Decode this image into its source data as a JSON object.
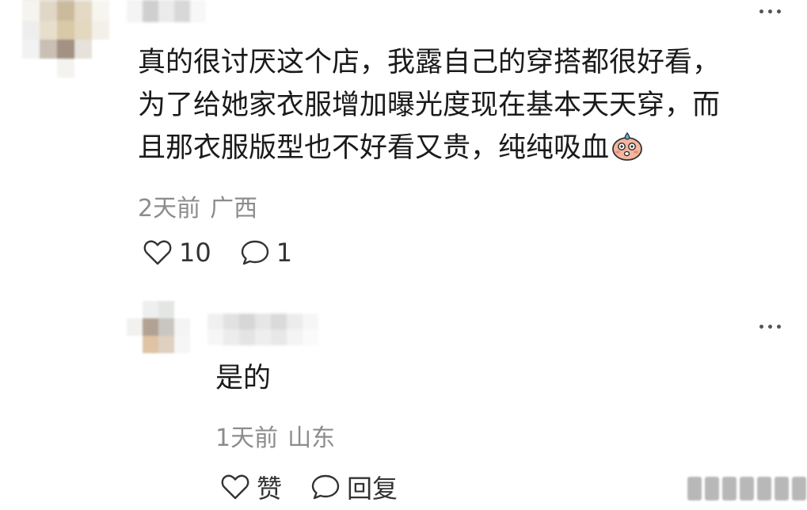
{
  "comment": {
    "text_lines": [
      "真的很讨厌这个店，我露自己的穿搭都很好看，",
      "为了给她家衣服增加曝光度现在基本天天穿，而",
      "且那衣服版型也不好看又贵，纯纯吸血"
    ],
    "emoji": "sweat-face-emoji",
    "time": "2天前",
    "location": "广西",
    "like_count": "10",
    "reply_count": "1"
  },
  "reply": {
    "text": "是的",
    "time": "1天前",
    "location": "山东",
    "like_label": "赞",
    "reply_label": "回复"
  },
  "icons": {
    "more": "more-dots-icon",
    "like": "heart-outline-icon",
    "comment": "speech-bubble-icon"
  },
  "colors": {
    "text": "#1a1a1a",
    "meta": "#8c8c8c",
    "icon": "#333333",
    "background": "#ffffff"
  }
}
